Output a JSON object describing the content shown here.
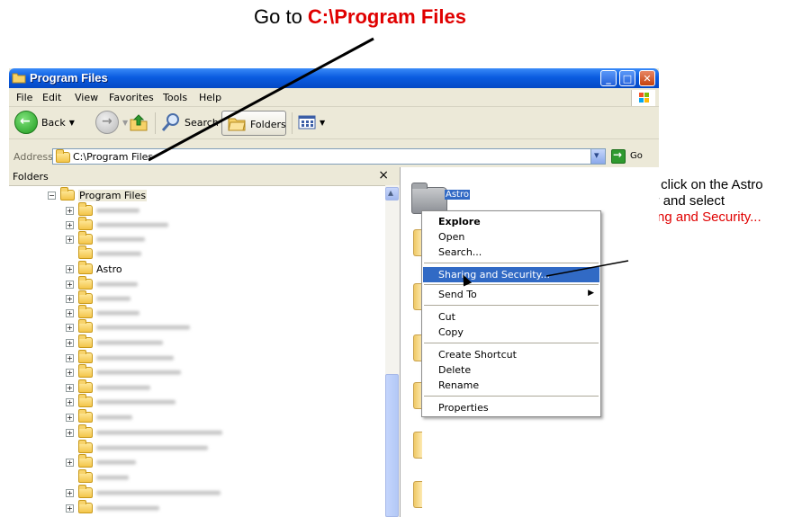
{
  "annotations": {
    "top_prefix": "Go to ",
    "top_path": "C:\\Program Files",
    "right_line1": "Right  click on the Astro",
    "right_line2": "folder and select",
    "right_line3": "Sharing and Security..."
  },
  "window": {
    "title": "Program Files",
    "menu": [
      "File",
      "Edit",
      "View",
      "Favorites",
      "Tools",
      "Help"
    ],
    "toolbar": {
      "back": "Back",
      "search": "Search",
      "folders": "Folders"
    },
    "address": {
      "label": "Address",
      "value": "C:\\Program Files",
      "go": "Go"
    }
  },
  "folders_pane": {
    "header": "Folders",
    "close": "×",
    "root": "Program Files",
    "visible_named_item": "Astro"
  },
  "files_pane": {
    "selected_folder": "Astro"
  },
  "context_menu": {
    "items": [
      {
        "label": "Explore"
      },
      {
        "label": "Open"
      },
      {
        "label": "Search..."
      },
      {
        "label": "Sharing and Security..."
      },
      {
        "label": "Send To"
      },
      {
        "label": "Cut"
      },
      {
        "label": "Copy"
      },
      {
        "label": "Create Shortcut"
      },
      {
        "label": "Delete"
      },
      {
        "label": "Rename"
      },
      {
        "label": "Properties"
      }
    ]
  },
  "colors": {
    "annotation_red": "#e00000",
    "selection_blue": "#316ac5",
    "titlebar_blue": "#0a5ce0"
  },
  "icons": [
    "folder-icon",
    "back-arrow-icon",
    "forward-arrow-icon",
    "up-folder-icon",
    "search-magnifier-icon",
    "folders-icon",
    "views-icon",
    "go-arrow-icon",
    "windows-logo-icon",
    "mouse-cursor-icon"
  ]
}
